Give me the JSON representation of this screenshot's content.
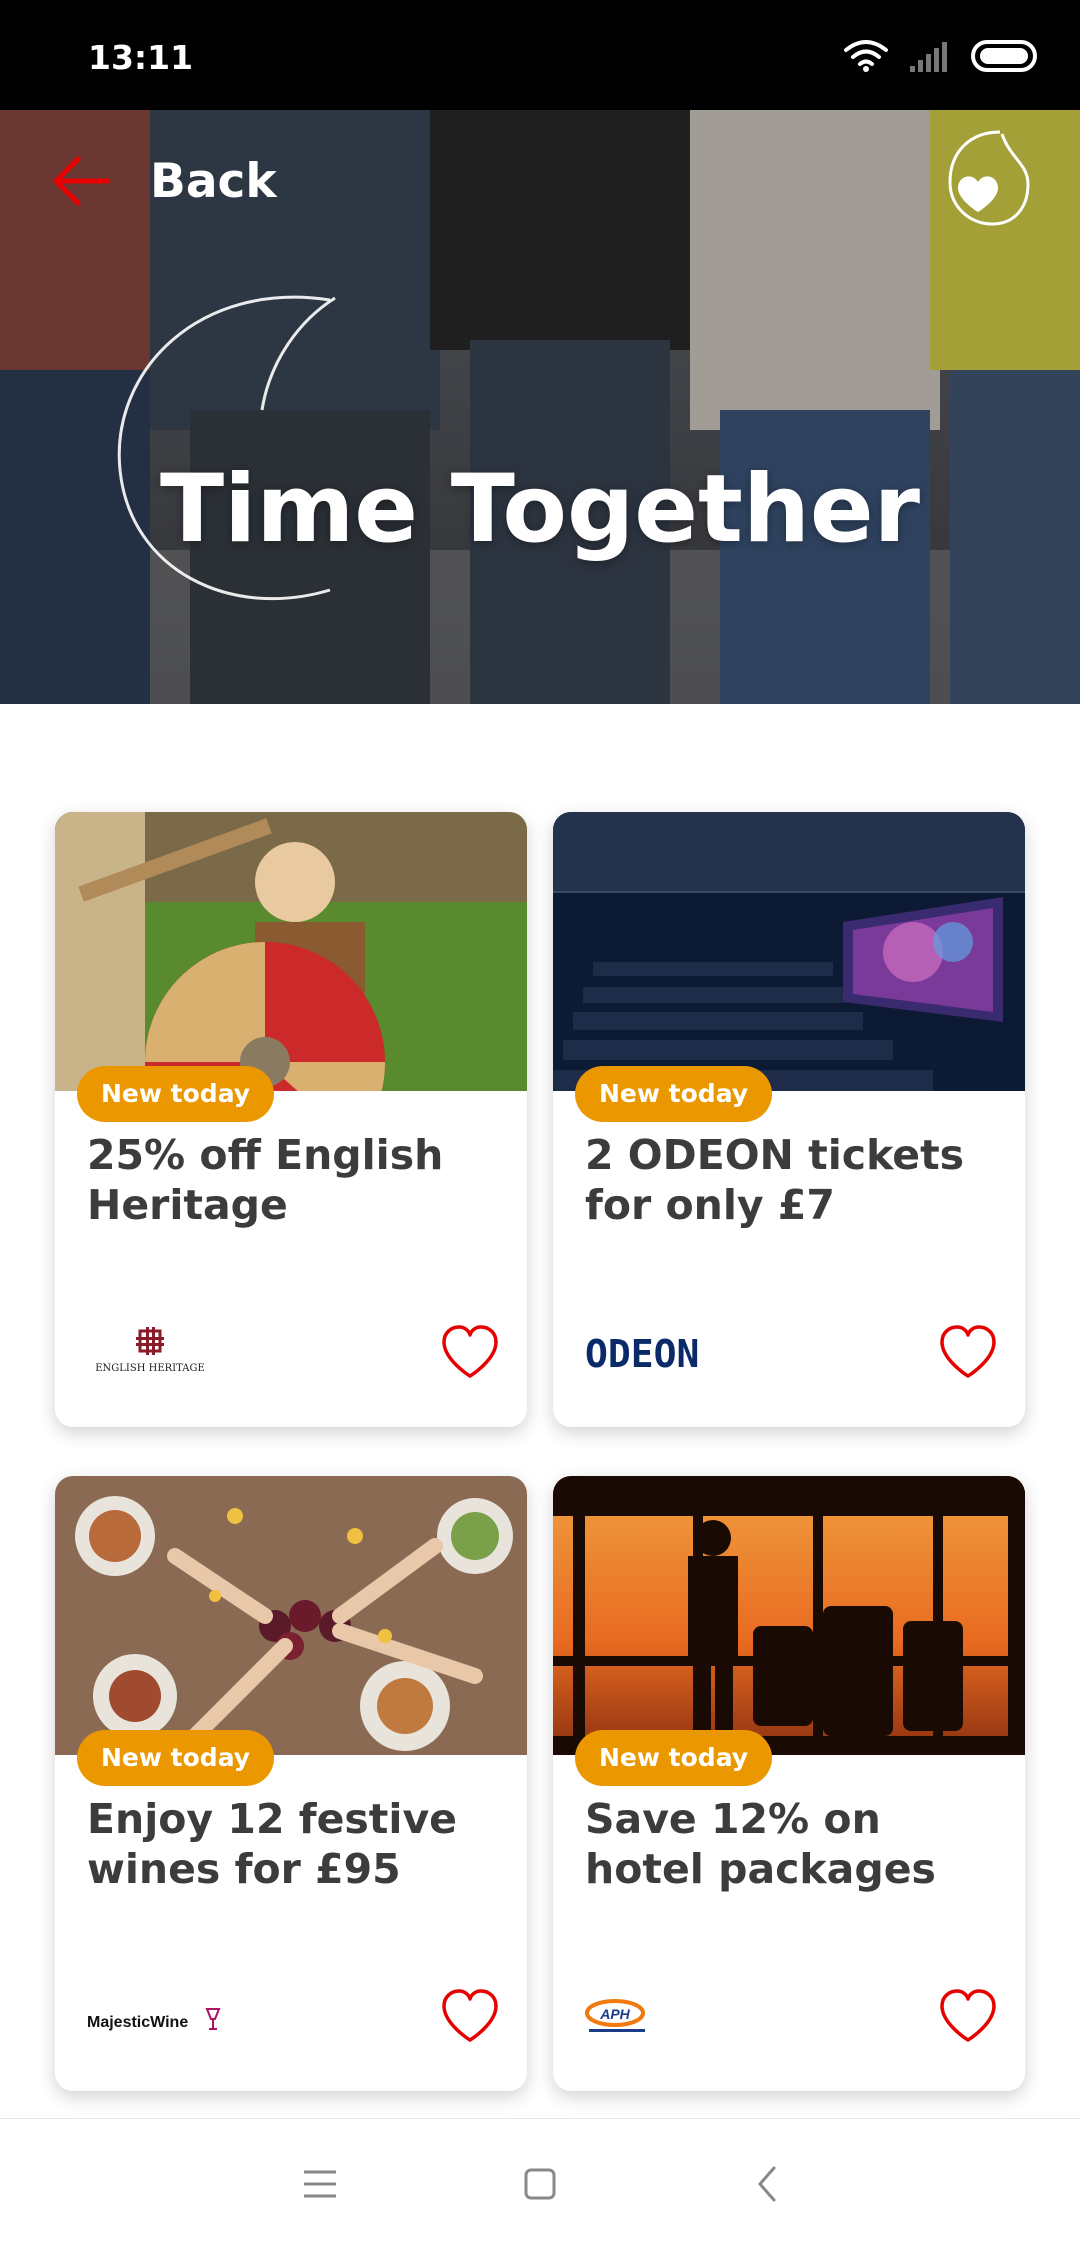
{
  "status_bar": {
    "time": "13:11"
  },
  "header": {
    "back_label": "Back"
  },
  "hero": {
    "title": "Time Together"
  },
  "offers": [
    {
      "badge": "New today",
      "title": "25% off English Heritage",
      "brand": "ENGLISH HERITAGE"
    },
    {
      "badge": "New today",
      "title": "2 ODEON tickets for only £7",
      "brand": "ODEON"
    },
    {
      "badge": "New today",
      "title": "Enjoy 12 festive wines for £95",
      "brand": "MajesticWine"
    },
    {
      "badge": "New today",
      "title": "Save 12% on hotel packages",
      "brand": "APH"
    }
  ],
  "colors": {
    "accent": "#e60000",
    "badge": "#eb9700",
    "text": "#3c3c3c"
  }
}
